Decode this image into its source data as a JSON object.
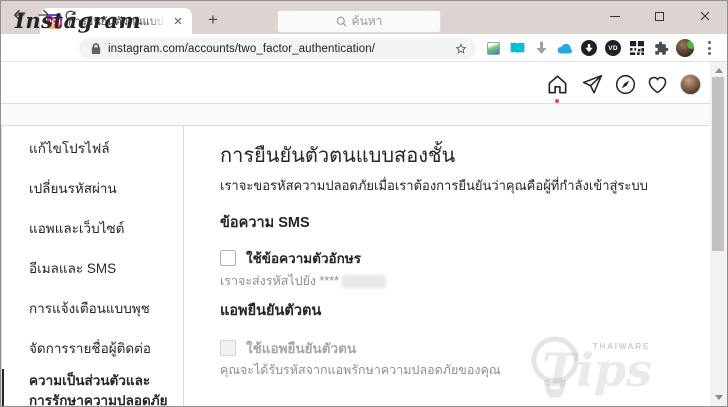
{
  "browser": {
    "tab_title": "การยืนยันตัวตนแบบสองชั้น • Instagram",
    "new_tab_glyph": "+",
    "url": "instagram.com/accounts/two_factor_authentication/",
    "extension_badges": {
      "vd": "VD"
    },
    "colors": {
      "tabstrip_bg": "#ddd3d0",
      "omnibox_bg": "#f1f3f4",
      "icon_gray": "#5f6368"
    }
  },
  "instagram": {
    "logo_text": "Instagram",
    "search_placeholder": "ค้นหา",
    "notification_dot_color": "#ed4956"
  },
  "sidebar": {
    "items": [
      {
        "label": "แก้ไขโปรไฟล์",
        "active": false
      },
      {
        "label": "เปลี่ยนรหัสผ่าน",
        "active": false
      },
      {
        "label": "แอพและเว็บไซต์",
        "active": false
      },
      {
        "label": "อีเมลและ SMS",
        "active": false
      },
      {
        "label": "การแจ้งเตือนแบบพุช",
        "active": false
      },
      {
        "label": "จัดการรายชื่อผู้ติดต่อ",
        "active": false
      },
      {
        "label": "ความเป็นส่วนตัวและการรักษาความปลอดภัย",
        "active": true
      }
    ]
  },
  "content": {
    "title": "การยืนยันตัวตนแบบสองชั้น",
    "subtitle": "เราจะขอรหัสความปลอดภัยเมื่อเราต้องการยืนยันว่าคุณคือผู้ที่กำลังเข้าสู่ระบบ",
    "sms": {
      "heading": "ข้อความ SMS",
      "checkbox_label": "ใช้ข้อความตัวอักษร",
      "checked": false,
      "description_prefix": "เราจะส่งรหัสไปยัง ****"
    },
    "auth_app": {
      "heading": "แอพยืนยันตัวตน",
      "checkbox_label": "ใช้แอพยืนยันตัวตน",
      "checked": false,
      "disabled": true,
      "description": "คุณจะได้รับรหัสจากแอพรักษาความปลอดภัยของคุณ"
    },
    "colors": {
      "text_primary": "#262626",
      "text_secondary": "#8e8e8e",
      "border": "#dbdbdb",
      "page_bg": "#fafafa"
    }
  },
  "watermark": {
    "brand": "THAIWARE",
    "text": "Tips"
  }
}
